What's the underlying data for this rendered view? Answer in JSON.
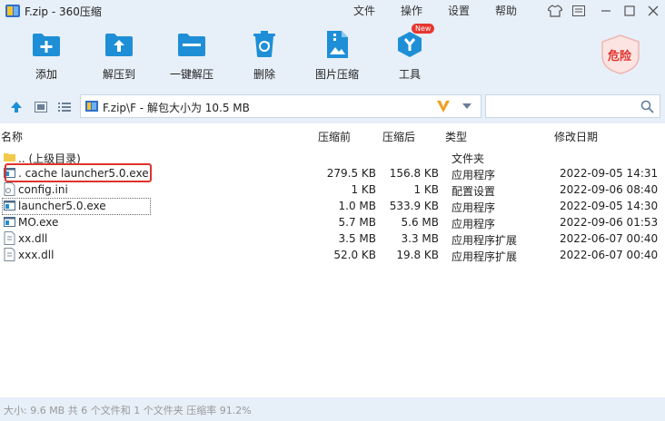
{
  "window": {
    "title": "F.zip - 360压缩",
    "menu": [
      "文件",
      "操作",
      "设置",
      "帮助"
    ]
  },
  "toolbar": {
    "add": "添加",
    "extract_to": "解压到",
    "one_click": "一键解压",
    "delete": "删除",
    "image_compress": "图片压缩",
    "tools": "工具",
    "new_badge": "New",
    "danger": "危险"
  },
  "address": {
    "path": "F.zip\\F - 解包大小为 10.5 MB",
    "search_placeholder": ""
  },
  "list": {
    "headers": {
      "name": "名称",
      "before": "压缩前",
      "after": "压缩后",
      "type": "类型",
      "modified": "修改日期"
    },
    "rows": [
      {
        "name": ".. (上级目录)",
        "before": "",
        "after": "",
        "type": "文件夹",
        "date": ""
      },
      {
        "name": ". cache launcher5.0.exe",
        "before": "279.5 KB",
        "after": "156.8 KB",
        "type": "应用程序",
        "date": "2022-09-05 14:31"
      },
      {
        "name": "config.ini",
        "before": "1 KB",
        "after": "1 KB",
        "type": "配置设置",
        "date": "2022-09-06 08:40"
      },
      {
        "name": "launcher5.0.exe",
        "before": "1.0 MB",
        "after": "533.9 KB",
        "type": "应用程序",
        "date": "2022-09-05 14:30"
      },
      {
        "name": "MO.exe",
        "before": "5.7 MB",
        "after": "5.6 MB",
        "type": "应用程序",
        "date": "2022-09-06 01:53"
      },
      {
        "name": "xx.dll",
        "before": "3.5 MB",
        "after": "3.3 MB",
        "type": "应用程序扩展",
        "date": "2022-06-07 00:40"
      },
      {
        "name": "xxx.dll",
        "before": "52.0 KB",
        "after": "19.8 KB",
        "type": "应用程序扩展",
        "date": "2022-06-07 00:40"
      }
    ]
  },
  "status": {
    "text": "大小: 9.6 MB 共 6 个文件和 1 个文件夹 压缩率 91.2%"
  },
  "colors": {
    "chrome_bg": "#e7eff8",
    "accent_blue": "#1e8fd6",
    "highlight_red": "#e0322c"
  }
}
